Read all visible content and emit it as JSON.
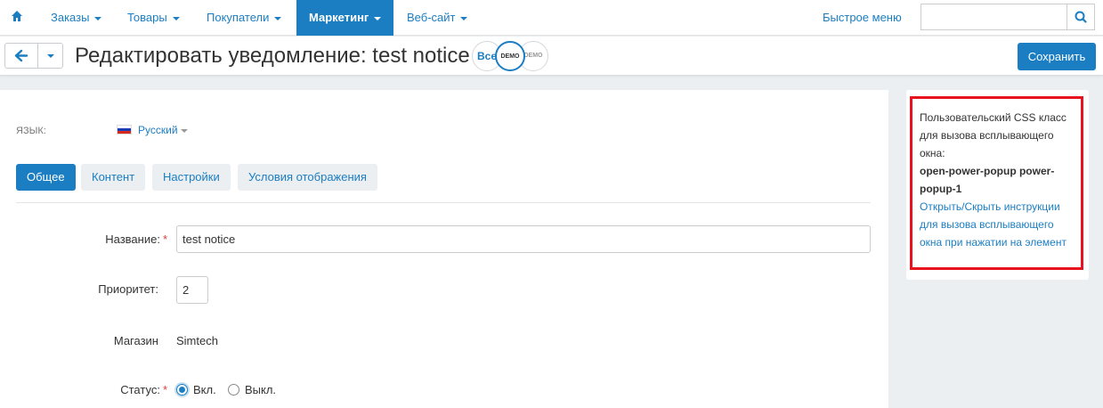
{
  "nav": {
    "items": [
      {
        "label": "Заказы"
      },
      {
        "label": "Товары"
      },
      {
        "label": "Покупатели"
      },
      {
        "label": "Маркетинг"
      },
      {
        "label": "Веб-сайт"
      }
    ],
    "quick_menu": "Быстрое меню",
    "search_placeholder": ""
  },
  "titlebar": {
    "title": "Редактировать уведомление: test notice",
    "storefronts": {
      "all": "Все",
      "demo1": "DEMO",
      "demo2": "DEMO"
    },
    "save_label": "Сохранить"
  },
  "form": {
    "language_label": "Язык:",
    "language_value": "Русский",
    "tabs": [
      {
        "label": "Общее"
      },
      {
        "label": "Контент"
      },
      {
        "label": "Настройки"
      },
      {
        "label": "Условия отображения"
      }
    ],
    "name_label": "Название:",
    "name_value": "test notice",
    "priority_label": "Приоритет:",
    "priority_value": "2",
    "store_label": "Магазин",
    "store_value": "Simtech",
    "status_label": "Статус:",
    "status_on": "Вкл.",
    "status_off": "Выкл.",
    "required_mark": "*"
  },
  "sidebar": {
    "css_text": "Пользовательский CSS класс для вызова всплывающего окна:",
    "css_class": "open-power-popup power-popup-1",
    "instructions_link": "Открыть/Скрыть инструкции для вызова всплывающего окна при нажатии на элемент"
  },
  "colors": {
    "accent": "#1b7ec2",
    "highlight": "#e8121f",
    "required": "#e23a3a"
  }
}
